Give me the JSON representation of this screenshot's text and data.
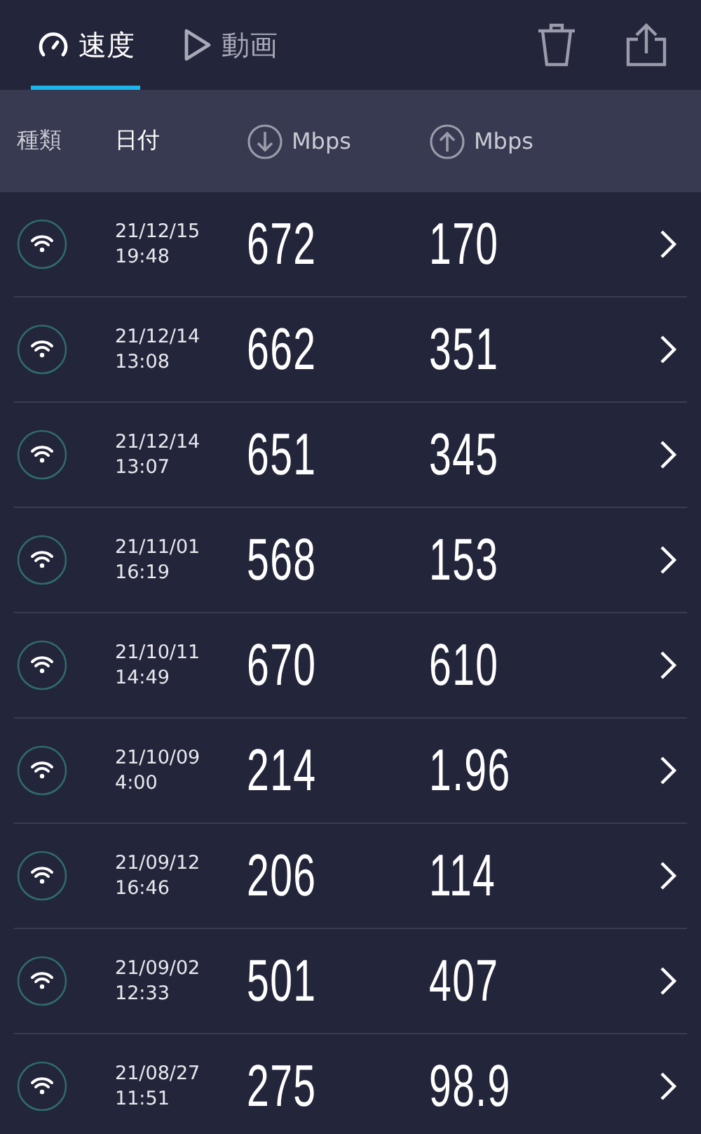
{
  "tabs": [
    {
      "label": "速度",
      "kind": "gauge",
      "selected": true
    },
    {
      "label": "動画",
      "kind": "play",
      "selected": false
    }
  ],
  "columns": {
    "type": "種類",
    "date": "日付",
    "download": "Mbps",
    "upload": "Mbps"
  },
  "rows": [
    {
      "date": "21/12/15",
      "time": "19:48",
      "download": "672",
      "upload": "170"
    },
    {
      "date": "21/12/14",
      "time": "13:08",
      "download": "662",
      "upload": "351"
    },
    {
      "date": "21/12/14",
      "time": "13:07",
      "download": "651",
      "upload": "345"
    },
    {
      "date": "21/11/01",
      "time": "16:19",
      "download": "568",
      "upload": "153"
    },
    {
      "date": "21/10/11",
      "time": "14:49",
      "download": "670",
      "upload": "610"
    },
    {
      "date": "21/10/09",
      "time": "4:00",
      "download": "214",
      "upload": "1.96"
    },
    {
      "date": "21/09/12",
      "time": "16:46",
      "download": "206",
      "upload": "114"
    },
    {
      "date": "21/09/02",
      "time": "12:33",
      "download": "501",
      "upload": "407"
    },
    {
      "date": "21/08/27",
      "time": "11:51",
      "download": "275",
      "upload": "98.9"
    }
  ]
}
